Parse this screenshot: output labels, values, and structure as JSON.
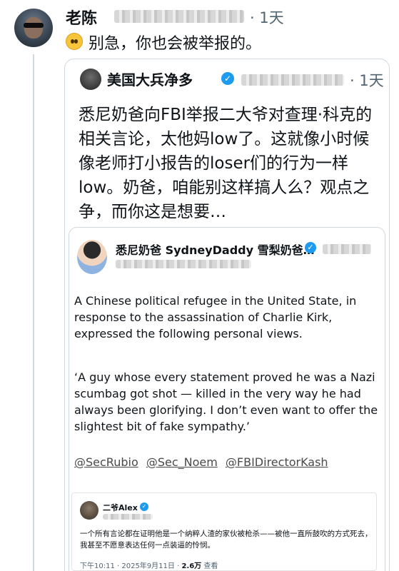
{
  "reply": {
    "author_name": "老陈",
    "timestamp": "· 1天",
    "emoji": "pleading-face",
    "text": "别急，你也会被举报的。"
  },
  "quoted_post": {
    "author_name": "美国大兵净多",
    "timestamp": "· 1天",
    "text": "悉尼奶爸向FBI举报二大爷对查理·科克的相关言论，太他妈low了。这就像小时候像老师打小报告的loser们的行为一样low。奶爸，咱能别这样搞人么？观点之争，而你这是想要…"
  },
  "nested_post": {
    "author_name": "悉尼奶爸 SydneyDaddy 雪梨奶爸…",
    "body": "A Chinese political refugee in the United State, in response to the assassination of Charlie Kirk, expressed the following personal views.",
    "quote": "‘A guy whose every statement proved he was a Nazi scumbag got shot — killed in the very way he had always been glorifying. I don’t even want to offer the slightest bit of fake sympathy.’",
    "mentions": [
      "@SecRubio",
      "@Sec_Noem",
      "@FBIDirectorKash"
    ]
  },
  "screenshot_post": {
    "author_name": "二爷Alex",
    "text": "一个所有言论都在证明他是一个纳粹人渣的家伙被枪杀——被他一直所鼓吹的方式死去，我甚至不愿意表达任何一点装逼的怜悯。",
    "meta_time": "下午10:11 · 2025年9月11日 · ",
    "meta_views_count": "2.6万",
    "meta_views_label": " 查看"
  },
  "colors": {
    "verified": "#1d9bf0",
    "muted_text": "#536471",
    "border": "#cfd9de"
  }
}
